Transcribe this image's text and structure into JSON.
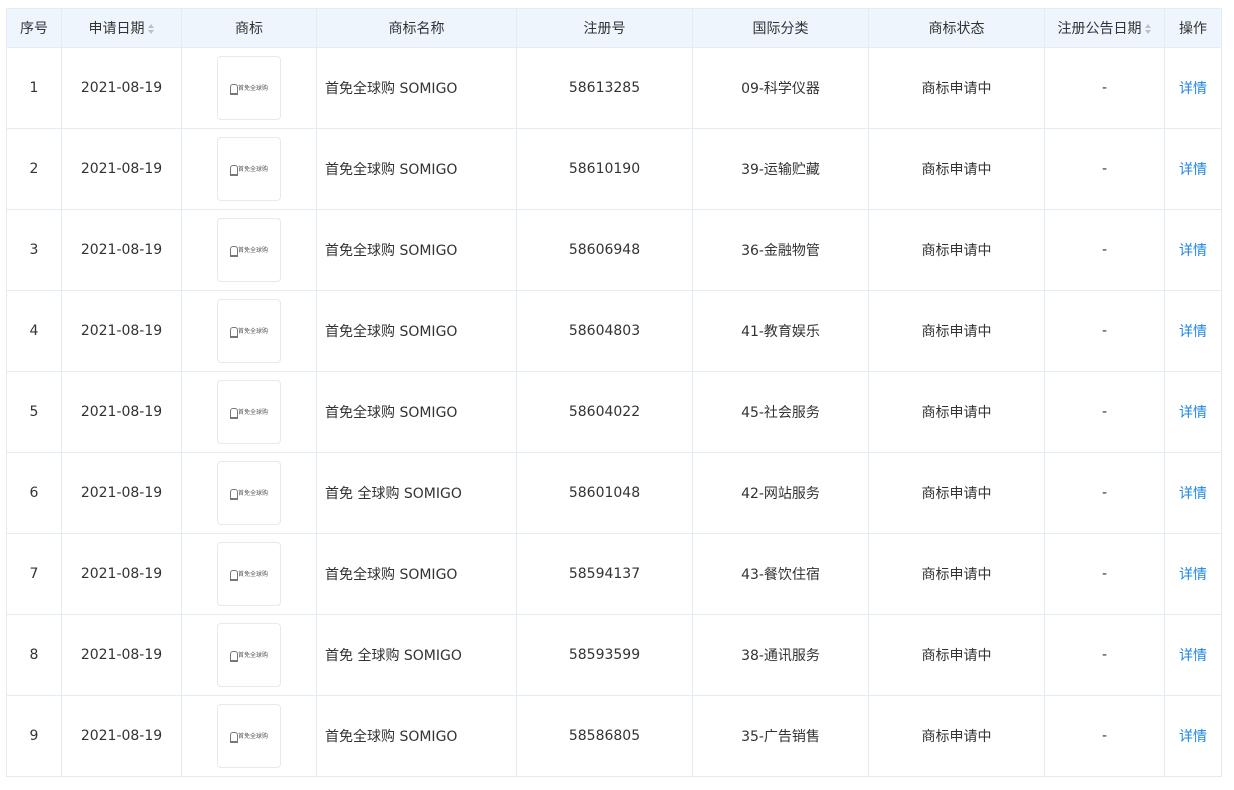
{
  "columns": {
    "index": "序号",
    "apply_date": "申请日期",
    "trademark": "商标",
    "name": "商标名称",
    "reg_no": "注册号",
    "intl_class": "国际分类",
    "status": "商标状态",
    "pub_date": "注册公告日期",
    "action": "操作"
  },
  "rows": [
    {
      "index": "1",
      "apply_date": "2021-08-19",
      "logo_text": "首免全球购",
      "name": "首免全球购 SOMIGO",
      "reg_no": "58613285",
      "intl_class": "09-科学仪器",
      "status": "商标申请中",
      "pub_date": "-",
      "action": "详情"
    },
    {
      "index": "2",
      "apply_date": "2021-08-19",
      "logo_text": "首免全球购",
      "name": "首免全球购 SOMIGO",
      "reg_no": "58610190",
      "intl_class": "39-运输贮藏",
      "status": "商标申请中",
      "pub_date": "-",
      "action": "详情"
    },
    {
      "index": "3",
      "apply_date": "2021-08-19",
      "logo_text": "首免全球购",
      "name": "首免全球购 SOMIGO",
      "reg_no": "58606948",
      "intl_class": "36-金融物管",
      "status": "商标申请中",
      "pub_date": "-",
      "action": "详情"
    },
    {
      "index": "4",
      "apply_date": "2021-08-19",
      "logo_text": "首免全球购",
      "name": "首免全球购 SOMIGO",
      "reg_no": "58604803",
      "intl_class": "41-教育娱乐",
      "status": "商标申请中",
      "pub_date": "-",
      "action": "详情"
    },
    {
      "index": "5",
      "apply_date": "2021-08-19",
      "logo_text": "首免全球购",
      "name": "首免全球购 SOMIGO",
      "reg_no": "58604022",
      "intl_class": "45-社会服务",
      "status": "商标申请中",
      "pub_date": "-",
      "action": "详情"
    },
    {
      "index": "6",
      "apply_date": "2021-08-19",
      "logo_text": "首免全球购",
      "name": "首免 全球购 SOMIGO",
      "reg_no": "58601048",
      "intl_class": "42-网站服务",
      "status": "商标申请中",
      "pub_date": "-",
      "action": "详情"
    },
    {
      "index": "7",
      "apply_date": "2021-08-19",
      "logo_text": "首免全球购",
      "name": "首免全球购 SOMIGO",
      "reg_no": "58594137",
      "intl_class": "43-餐饮住宿",
      "status": "商标申请中",
      "pub_date": "-",
      "action": "详情"
    },
    {
      "index": "8",
      "apply_date": "2021-08-19",
      "logo_text": "首免全球购",
      "name": "首免 全球购 SOMIGO",
      "reg_no": "58593599",
      "intl_class": "38-通讯服务",
      "status": "商标申请中",
      "pub_date": "-",
      "action": "详情"
    },
    {
      "index": "9",
      "apply_date": "2021-08-19",
      "logo_text": "首免全球购",
      "name": "首免全球购 SOMIGO",
      "reg_no": "58586805",
      "intl_class": "35-广告销售",
      "status": "商标申请中",
      "pub_date": "-",
      "action": "详情"
    }
  ],
  "colors": {
    "header_bg": "#eef5fd",
    "border": "#e3ecf3",
    "link": "#1e86e6",
    "text": "#333333"
  },
  "icons": {
    "sort": "sort-caret-icon",
    "logo": "trademark-logo-image"
  }
}
